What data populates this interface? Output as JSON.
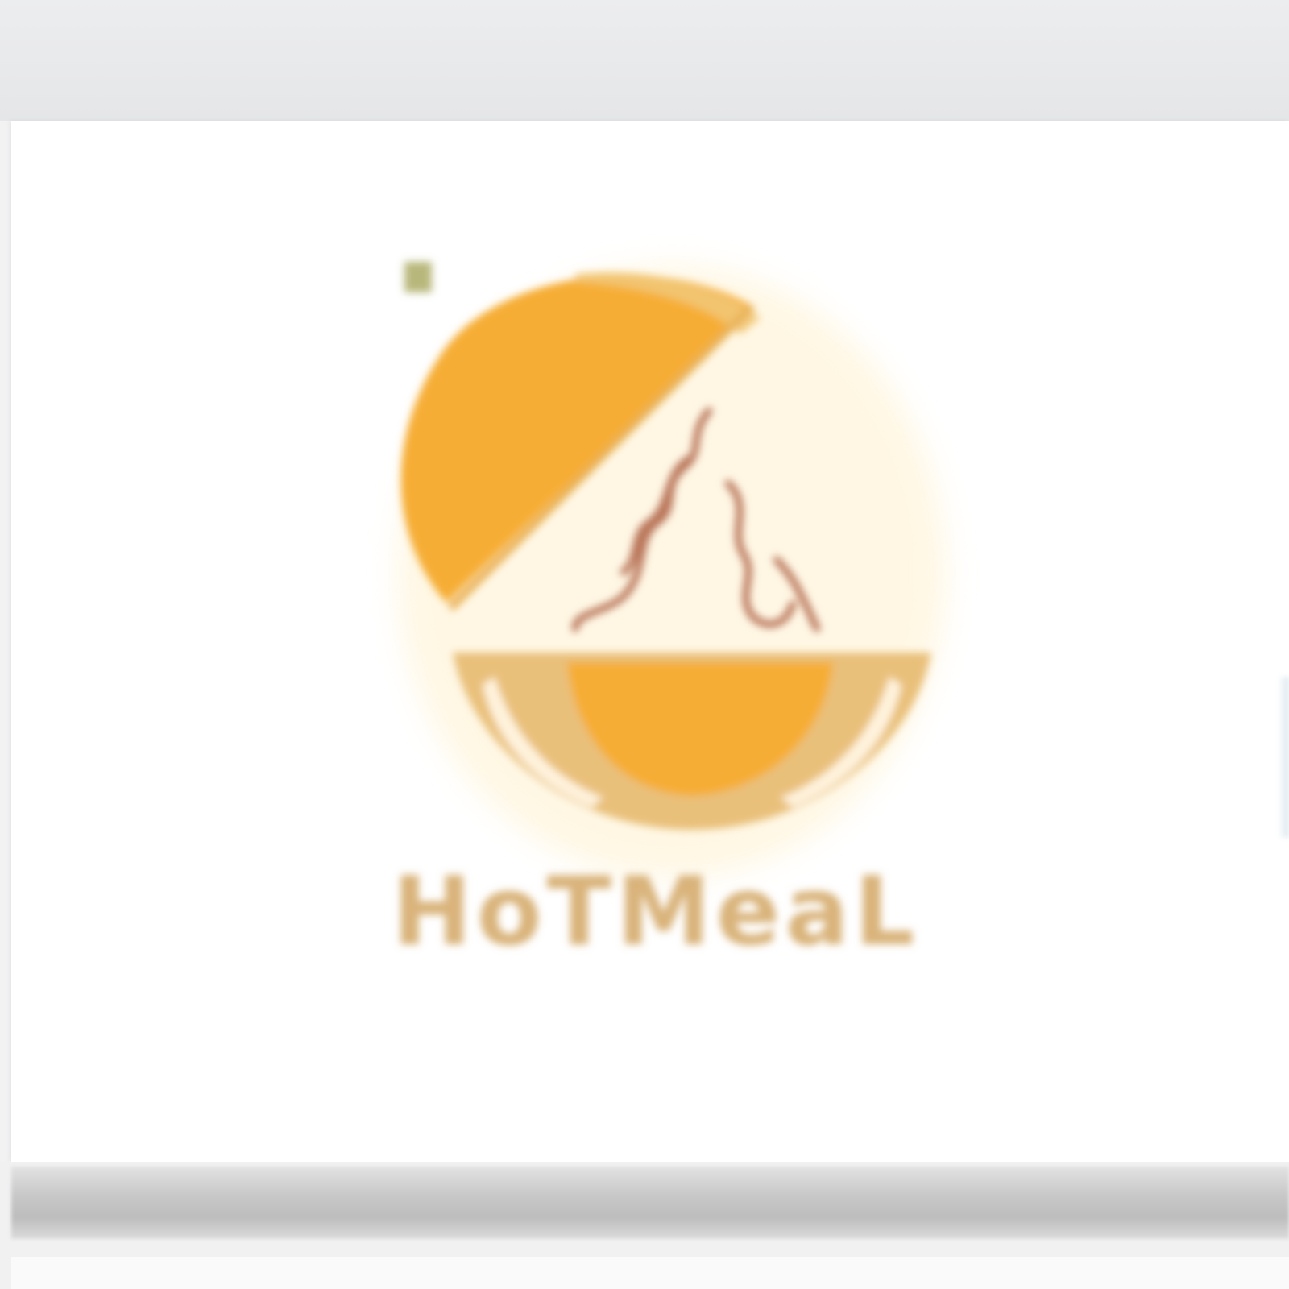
{
  "brand": {
    "name": "HoTMeaL"
  },
  "colors": {
    "background": "#e9eaeb",
    "card": "#ffffff",
    "cloche_orange": "#f6ad35",
    "bowl_gold": "#e9c07a",
    "steam_brown": "#b9765a",
    "wordmark": "#d9b37a"
  },
  "icons": {
    "logo": "cloche-bowl-steam-icon"
  }
}
